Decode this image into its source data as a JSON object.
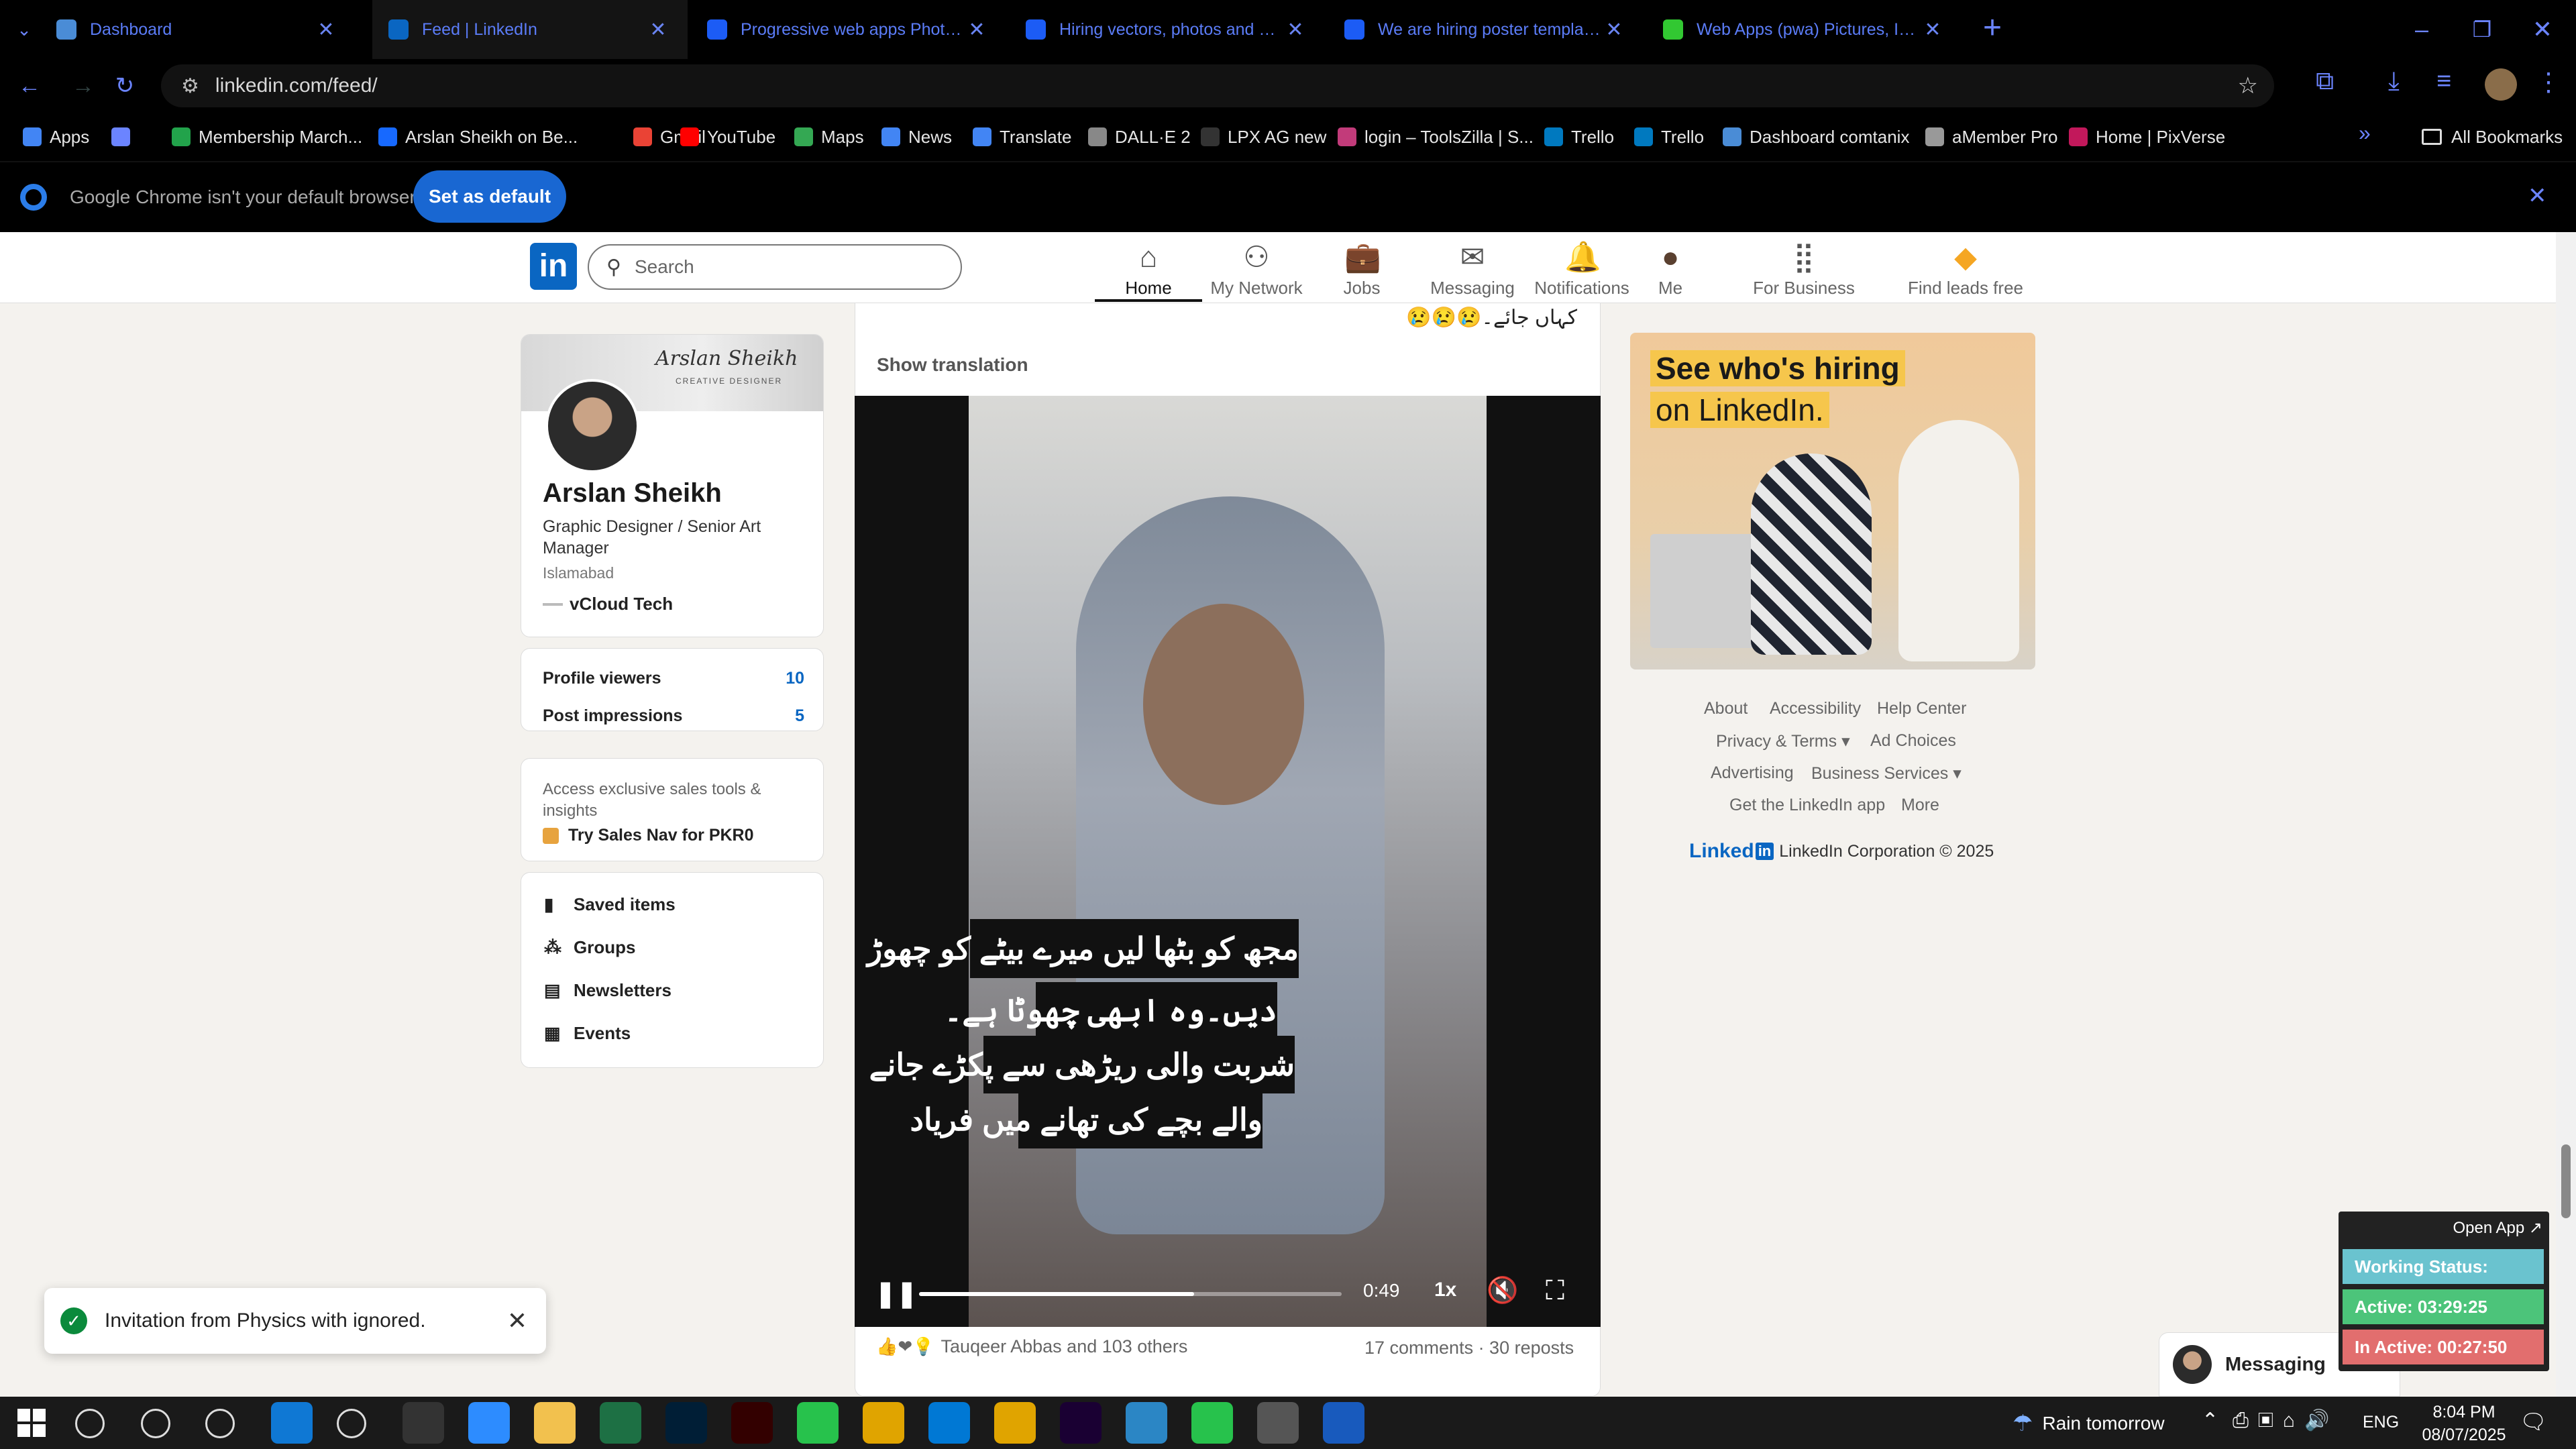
{
  "browser": {
    "tabs": [
      {
        "label": "Dashboard",
        "icon": "dashboard-tab-icon",
        "color": "#4a8cd6"
      },
      {
        "label": "Feed | LinkedIn",
        "icon": "linkedin-tab-icon",
        "color": "#0a66c2"
      },
      {
        "label": "Progressive web apps Photos |",
        "icon": "freepik-tab-icon",
        "color": "#1c5cf5"
      },
      {
        "label": "Hiring vectors, photos and PSD",
        "icon": "freepik-tab-icon",
        "color": "#1c5cf5"
      },
      {
        "label": "We are hiring poster template |",
        "icon": "freepik-tab-icon",
        "color": "#1c5cf5"
      },
      {
        "label": "Web Apps (pwa) Pictures, Imag",
        "icon": "web-apps-tab-icon",
        "color": "#32c832"
      }
    ],
    "new_tab": "+",
    "url": "linkedin.com/feed/",
    "bookmarks": [
      {
        "label": "Apps",
        "color": "#4285f4"
      },
      {
        "label": "",
        "color": "#6b84ff"
      },
      {
        "label": "Membership March...",
        "color": "#22a34b"
      },
      {
        "label": "Arslan Sheikh on Be...",
        "color": "#1769ff"
      },
      {
        "label": "Gmail",
        "color": "#ea4335"
      },
      {
        "label": "YouTube",
        "color": "#ff0000"
      },
      {
        "label": "Maps",
        "color": "#34a853"
      },
      {
        "label": "News",
        "color": "#4285f4"
      },
      {
        "label": "Translate",
        "color": "#4285f4"
      },
      {
        "label": "DALL·E 2",
        "color": "#888888"
      },
      {
        "label": "LPX AG new",
        "color": "#333333"
      },
      {
        "label": "login – ToolsZilla | S...",
        "color": "#c23b7a"
      },
      {
        "label": "Trello",
        "color": "#0079bf"
      },
      {
        "label": "Trello",
        "color": "#0079bf"
      },
      {
        "label": "Dashboard comtanix",
        "color": "#4a8cd6"
      },
      {
        "label": "aMember Pro",
        "color": "#999999"
      },
      {
        "label": "Home | PixVerse",
        "color": "#c2185b"
      }
    ],
    "all_bookmarks": "All Bookmarks",
    "infobar_text": "Google Chrome isn't your default browser",
    "set_default": "Set as default"
  },
  "linkedin": {
    "search_placeholder": "Search",
    "nav": [
      {
        "label": "Home",
        "icon": "home-icon",
        "active": true
      },
      {
        "label": "My Network",
        "icon": "network-icon"
      },
      {
        "label": "Jobs",
        "icon": "jobs-icon"
      },
      {
        "label": "Messaging",
        "icon": "messaging-icon"
      },
      {
        "label": "Notifications",
        "icon": "bell-icon"
      },
      {
        "label": "Me",
        "icon": "avatar"
      },
      {
        "label": "For Business",
        "icon": "grid-icon"
      },
      {
        "label": "Find leads free",
        "icon": "leads-icon"
      }
    ],
    "profile": {
      "banner_title": "Arslan Sheikh",
      "banner_sub": "CREATIVE DESIGNER",
      "name": "Arslan Sheikh",
      "headline": "Graphic Designer / Senior Art Manager",
      "location": "Islamabad",
      "company": "vCloud Tech"
    },
    "stats": [
      {
        "label": "Profile viewers",
        "value": "10"
      },
      {
        "label": "Post impressions",
        "value": "5"
      }
    ],
    "premium": {
      "text": "Access exclusive sales tools & insights",
      "cta": "Try Sales Nav for PKR0"
    },
    "shortcuts": [
      "Saved items",
      "Groups",
      "Newsletters",
      "Events"
    ],
    "post": {
      "caption_tail": "کہاں جائے۔😢😢😢",
      "show_translation": "Show translation",
      "subtitle_lines": [
        "مجھ کو بٹھا لیں میرے بیٹے کو چھوڑ",
        "دیں۔وہ ابھی چھوٹا ہے۔",
        "شربت والی ریڑھی سے پکڑے جانے",
        "والے بچے کی تھانے میں فریاد"
      ],
      "time": "0:49",
      "speed": "1x",
      "progress": 0.65,
      "reactions": "Tauqeer Abbas and 103 others",
      "comments": "17 comments · 30 reposts"
    },
    "ad": {
      "line1": "See who's hiring",
      "line2": "on LinkedIn."
    },
    "footer": {
      "row1": [
        "About",
        "Accessibility",
        "Help Center"
      ],
      "row2": [
        "Privacy & Terms ▾",
        "Ad Choices"
      ],
      "row3": [
        "Advertising",
        "Business Services ▾"
      ],
      "row4": [
        "Get the LinkedIn app",
        "More"
      ],
      "copyright": "LinkedIn Corporation © 2025",
      "logo": "Linked"
    },
    "messaging": "Messaging"
  },
  "toast": {
    "text": "Invitation from Physics with ignored."
  },
  "tracker": {
    "open_app": "Open App ↗",
    "status": "Working Status: Active",
    "active": "Active: 03:29:25",
    "inactive": "In Active: 00:27:50"
  },
  "taskbar": {
    "weather": "Rain tomorrow",
    "lang": "ENG",
    "time": "8:04 PM",
    "date": "08/07/2025"
  }
}
